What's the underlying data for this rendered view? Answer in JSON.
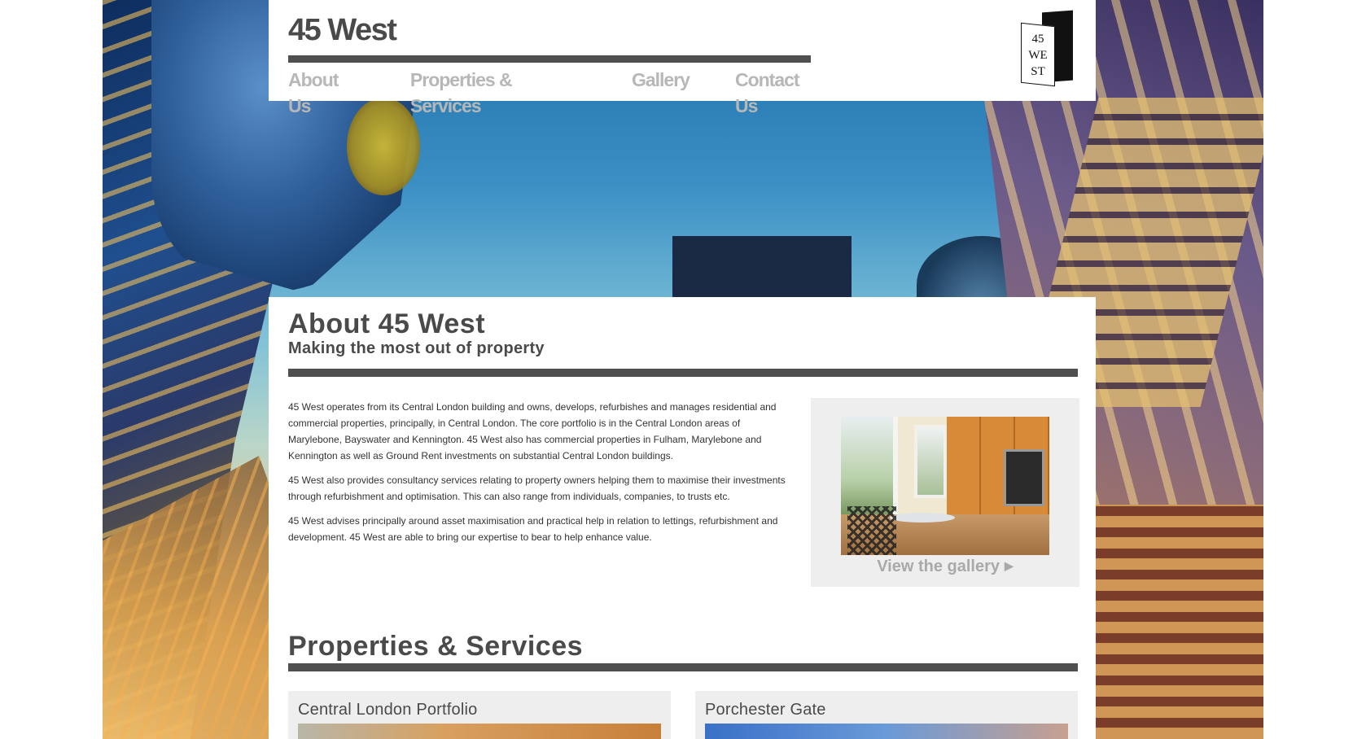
{
  "header": {
    "brand": "45 West",
    "nav": [
      {
        "label": "About Us"
      },
      {
        "label": "Properties & Services"
      },
      {
        "label": "Gallery"
      },
      {
        "label": "Contact Us"
      }
    ],
    "logo_text": "45\nWE\nST"
  },
  "about": {
    "title": "About 45 West",
    "subtitle": "Making the most out of property",
    "paragraphs": [
      "45 West operates from its Central London building and owns, develops, refurbishes and manages residential and commercial properties, principally, in Central London. The core portfolio is in the Central London areas of Marylebone, Bayswater and Kennington. 45 West also has commercial properties in Fulham, Marylebone and Kennington as well as Ground Rent investments on substantial Central London buildings.",
      "45 West also provides consultancy services relating to property owners helping them to maximise their investments through refurbishment and optimisation. This can also range from individuals, companies, to trusts etc.",
      "45 West advises principally around asset maximisation and practical help in relation to lettings, refurbishment and development. 45 West are able to bring our expertise to bear to help enhance value."
    ],
    "gallery_link": "View the gallery",
    "gallery_arrow": "▶"
  },
  "properties": {
    "title": "Properties & Services",
    "cards": [
      {
        "title": "Central London Portfolio"
      },
      {
        "title": "Porchester Gate"
      }
    ]
  },
  "colors": {
    "accent_bar": "#4f4f4f",
    "nav_text": "#b7b7b7",
    "heading_text": "#4a4a4a",
    "panel_grey": "#eeeeee"
  }
}
